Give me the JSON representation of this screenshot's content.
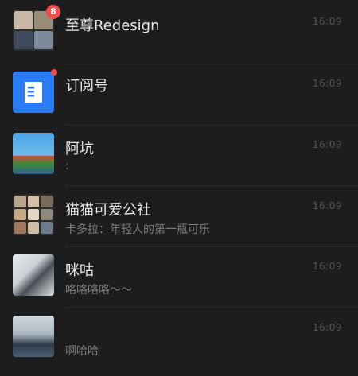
{
  "chats": [
    {
      "name": "至尊Redesign",
      "time": "16:09",
      "badge": "8",
      "preview": ""
    },
    {
      "name": "订阅号",
      "time": "16:09",
      "preview": ""
    },
    {
      "name": "阿坑",
      "time": "16:09",
      "preview": ":"
    },
    {
      "name": "猫猫可爱公社",
      "time": "16:09",
      "preview": "卡多拉：年轻人的第一瓶可乐"
    },
    {
      "name": "咪咕",
      "time": "16:09",
      "preview": "咯咯咯咯～～"
    },
    {
      "name": "",
      "time": "16:09",
      "preview": "啊哈哈"
    }
  ],
  "colors": {
    "background": "#1d1d1d",
    "badge": "#f14b4b",
    "subscription_icon": "#2a7cf6"
  },
  "icons": {
    "subscription": "document-icon"
  }
}
